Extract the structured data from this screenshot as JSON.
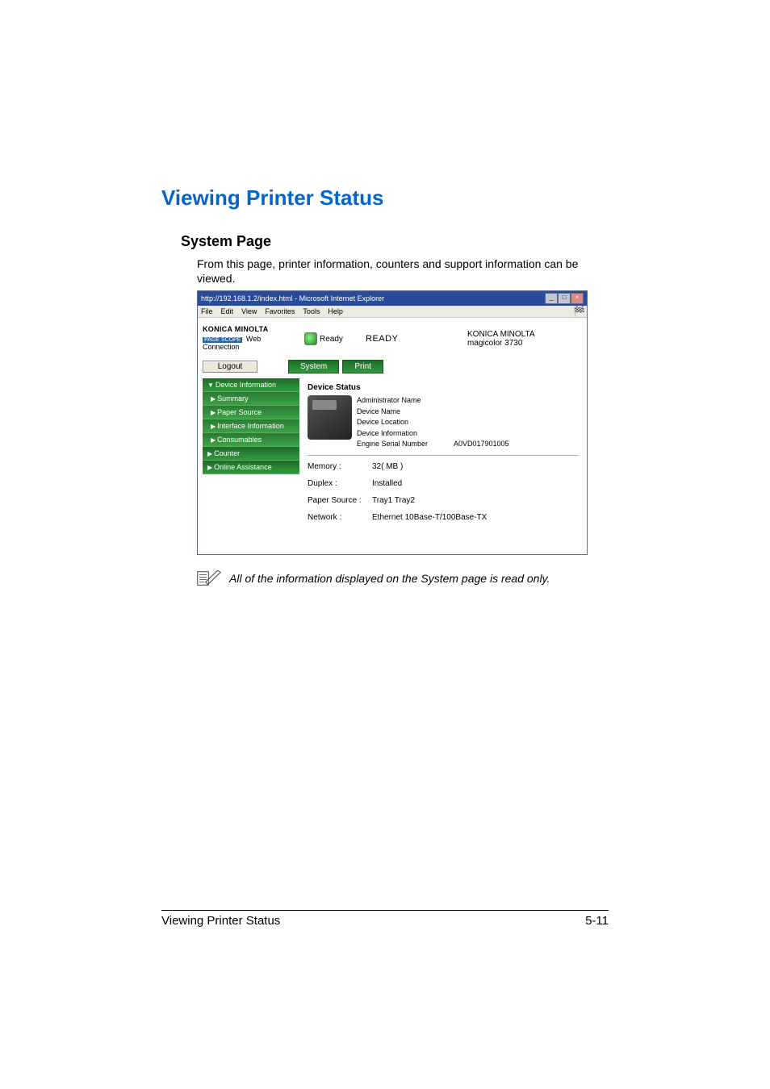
{
  "doc": {
    "title": "Viewing Printer Status",
    "subtitle": "System Page",
    "intro": "From this page, printer information, counters and support information can be viewed.",
    "note": "All of the information displayed on the System page is read only.",
    "footer_left": "Viewing Printer Status",
    "footer_right": "5-11"
  },
  "window": {
    "title": "http://192.168.1.2/index.html - Microsoft Internet Explorer",
    "menus": [
      "File",
      "Edit",
      "View",
      "Favorites",
      "Tools",
      "Help"
    ]
  },
  "header": {
    "brand": "KONICA MINOLTA",
    "pagescope_prefix": "PAGE SCOPE",
    "pagescope": "Web Connection",
    "status_label": "Ready",
    "ready": "READY",
    "device_brand": "KONICA MINOLTA",
    "device_model": "magicolor 3730"
  },
  "buttons": {
    "logout": "Logout"
  },
  "tabs": {
    "system": "System",
    "print": "Print"
  },
  "sidebar": {
    "items": [
      {
        "label": "Device Information",
        "prefix": "▼"
      },
      {
        "label": "Summary",
        "prefix": "▶"
      },
      {
        "label": "Paper Source",
        "prefix": "▶"
      },
      {
        "label": "Interface Information",
        "prefix": "▶"
      },
      {
        "label": "Consumables",
        "prefix": "▶"
      },
      {
        "label": "Counter",
        "prefix": "▶"
      },
      {
        "label": "Online Assistance",
        "prefix": "▶"
      }
    ]
  },
  "panel": {
    "title": "Device Status",
    "fields": {
      "admin_name_k": "Administrator Name",
      "admin_name_v": "",
      "dev_name_k": "Device Name",
      "dev_name_v": "",
      "dev_loc_k": "Device Location",
      "dev_loc_v": "",
      "dev_info_k": "Device Information",
      "dev_info_v": "",
      "engine_k": "Engine Serial Number",
      "engine_v": "A0VD017901005"
    },
    "info": {
      "memory_k": "Memory :",
      "memory_v": "32( MB )",
      "duplex_k": "Duplex :",
      "duplex_v": "Installed",
      "paper_k": "Paper Source :",
      "paper_v": "Tray1   Tray2",
      "network_k": "Network :",
      "network_v": "Ethernet 10Base-T/100Base-TX"
    }
  }
}
